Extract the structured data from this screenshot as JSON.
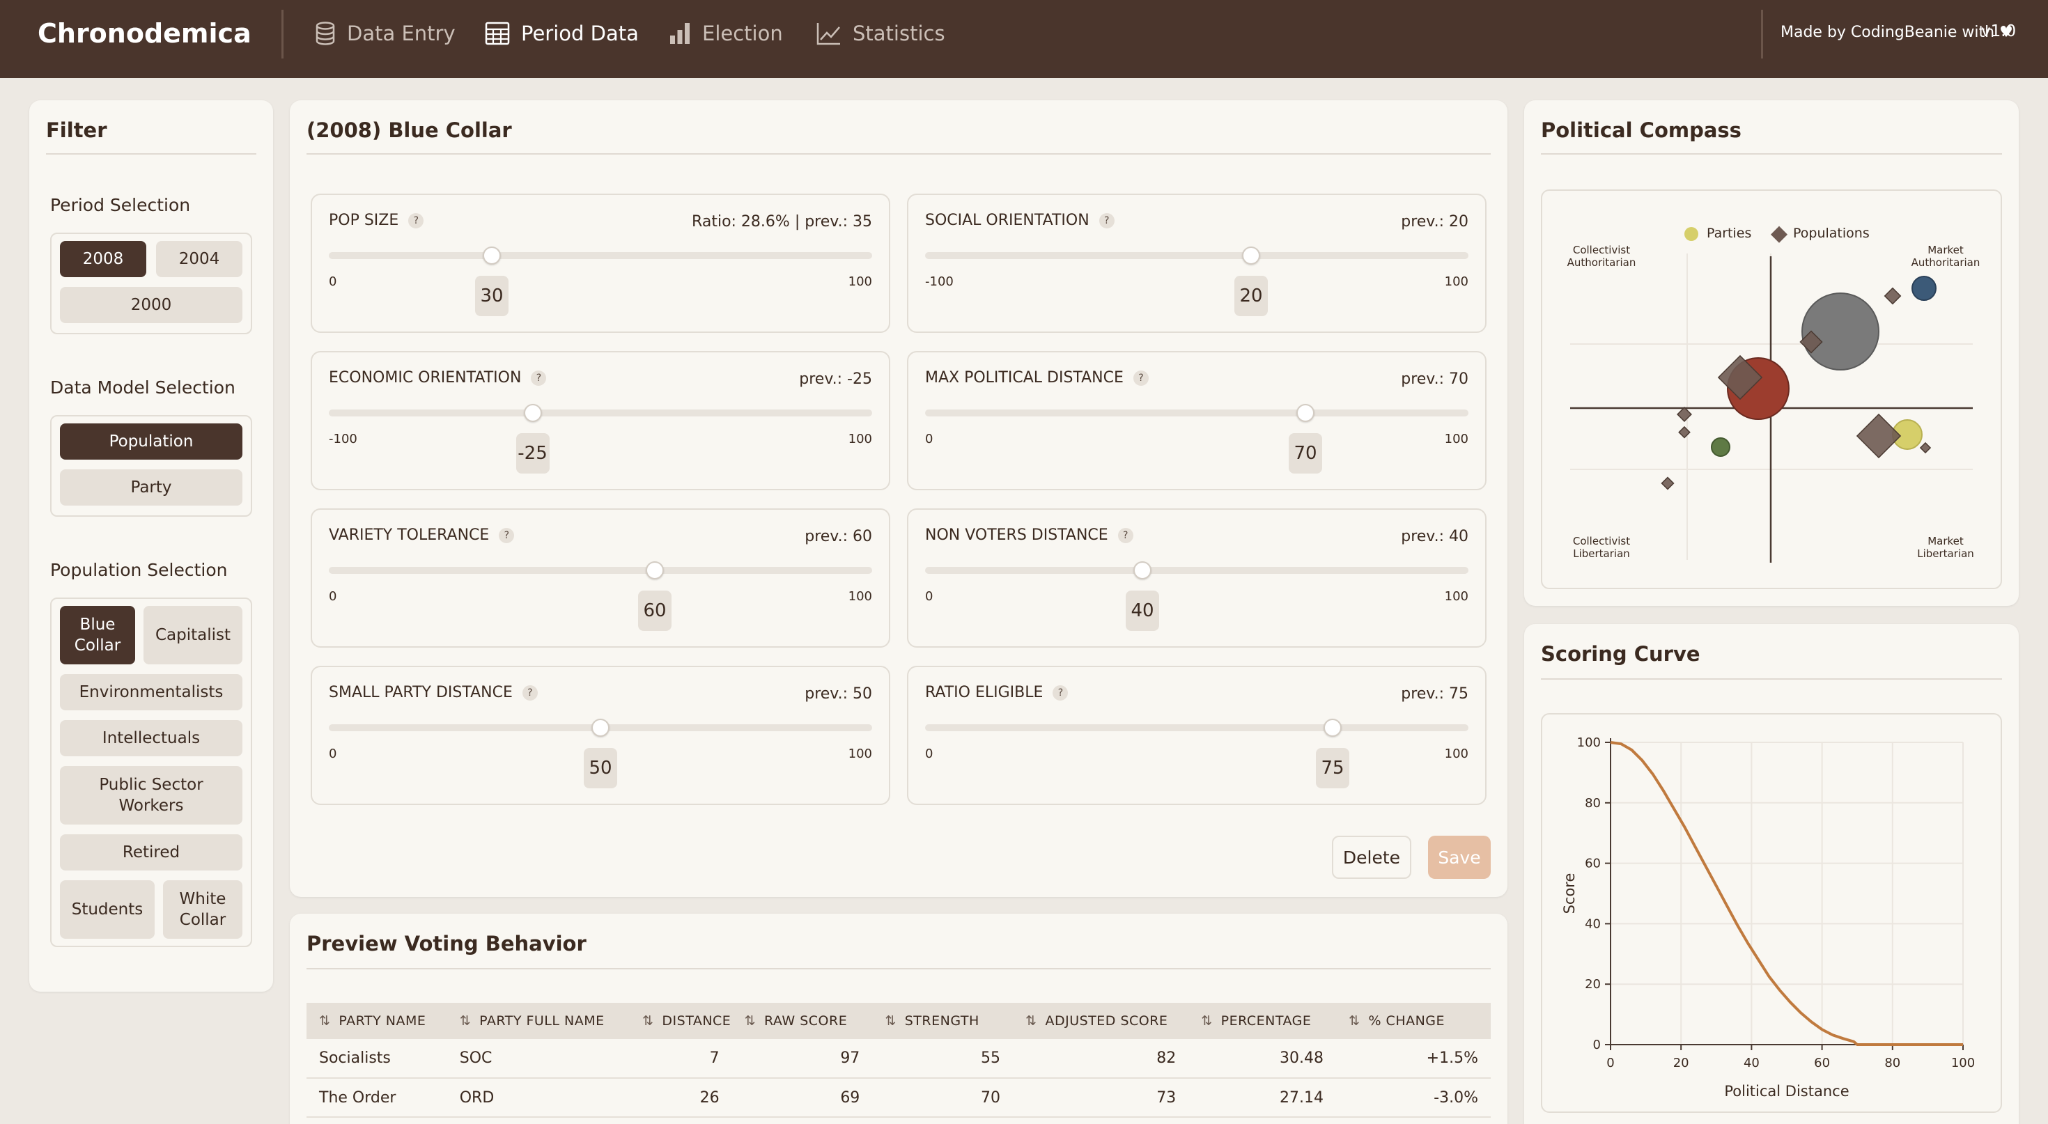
{
  "app": {
    "title": "Chronodemica",
    "made_by": "Made by CodingBeanie with",
    "version": "v1.0"
  },
  "nav": [
    {
      "label": "Data Entry",
      "icon": "database-icon"
    },
    {
      "label": "Period Data",
      "icon": "table-icon"
    },
    {
      "label": "Election",
      "icon": "bar-chart-icon"
    },
    {
      "label": "Statistics",
      "icon": "line-chart-icon"
    }
  ],
  "filter": {
    "title": "Filter",
    "period_label": "Period Selection",
    "periods": [
      "2008",
      "2004",
      "2000"
    ],
    "selected_period": "2008",
    "model_label": "Data Model Selection",
    "models": [
      "Population",
      "Party"
    ],
    "selected_model": "Population",
    "population_label": "Population Selection",
    "populations": [
      "Blue Collar",
      "Capitalist",
      "Environmentalists",
      "Intellectuals",
      "Public Sector Workers",
      "Retired",
      "Students",
      "White Collar"
    ],
    "selected_population": "Blue Collar"
  },
  "editor": {
    "title": "(2008) Blue Collar",
    "params": [
      {
        "label": "POP SIZE",
        "help": "?",
        "prev": "Ratio: 28.6% | prev.: 35",
        "min": "0",
        "max": "100",
        "value": "30",
        "level": 0.3
      },
      {
        "label": "SOCIAL ORIENTATION",
        "help": "?",
        "prev": "prev.: 20",
        "min": "-100",
        "max": "100",
        "value": "20",
        "level": 0.6
      },
      {
        "label": "ECONOMIC ORIENTATION",
        "help": "?",
        "prev": "prev.: -25",
        "min": "-100",
        "max": "100",
        "value": "-25",
        "level": 0.375
      },
      {
        "label": "MAX POLITICAL DISTANCE",
        "help": "?",
        "prev": "prev.: 70",
        "min": "0",
        "max": "100",
        "value": "70",
        "level": 0.7
      },
      {
        "label": "VARIETY TOLERANCE",
        "help": "?",
        "prev": "prev.: 60",
        "min": "0",
        "max": "100",
        "value": "60",
        "level": 0.6
      },
      {
        "label": "NON VOTERS DISTANCE",
        "help": "?",
        "prev": "prev.: 40",
        "min": "0",
        "max": "100",
        "value": "40",
        "level": 0.4
      },
      {
        "label": "SMALL PARTY DISTANCE",
        "help": "?",
        "prev": "prev.: 50",
        "min": "0",
        "max": "100",
        "value": "50",
        "level": 0.5
      },
      {
        "label": "RATIO ELIGIBLE",
        "help": "?",
        "prev": "prev.: 75",
        "min": "0",
        "max": "100",
        "value": "75",
        "level": 0.75
      }
    ],
    "delete_label": "Delete",
    "save_label": "Save"
  },
  "preview": {
    "title": "Preview Voting Behavior",
    "columns": [
      "PARTY NAME",
      "PARTY FULL NAME",
      "DISTANCE",
      "RAW SCORE",
      "STRENGTH",
      "ADJUSTED SCORE",
      "PERCENTAGE",
      "% CHANGE"
    ],
    "rows": [
      [
        "Socialists",
        "SOC",
        "7",
        "97",
        "55",
        "82",
        "30.48",
        "+1.5%"
      ],
      [
        "The Order",
        "ORD",
        "26",
        "69",
        "70",
        "73",
        "27.14",
        "-3.0%"
      ]
    ]
  },
  "compass": {
    "title": "Political Compass",
    "legend": [
      "Parties",
      "Populations"
    ],
    "quadrants": {
      "top_left": "Collectivist Authoritarian",
      "top_right": "Market Authoritarian",
      "bottom_left": "Collectivist Libertarian",
      "bottom_right": "Market Libertarian"
    },
    "colors": {
      "parties_legend": "#d6cf6a",
      "populations_legend": "#6e5a52"
    }
  },
  "scoring": {
    "title": "Scoring Curve",
    "chart_data": {
      "type": "line",
      "xlabel": "Political Distance",
      "ylabel": "Score",
      "xlim": [
        0,
        100
      ],
      "ylim": [
        0,
        100
      ],
      "xticks": [
        "0",
        "20",
        "40",
        "60",
        "80",
        "100"
      ],
      "yticks": [
        "0",
        "20",
        "40",
        "60",
        "80",
        "100"
      ],
      "x": [
        0,
        3,
        6,
        9,
        12,
        15,
        18,
        21,
        24,
        27,
        30,
        33,
        36,
        39,
        42,
        45,
        48,
        51,
        54,
        57,
        60,
        63,
        66,
        69,
        70,
        71,
        75,
        80,
        90,
        100
      ],
      "y": [
        100,
        99.5,
        97.5,
        94,
        89.5,
        84,
        78,
        72,
        65.5,
        59,
        52.5,
        46,
        39.5,
        33.5,
        28,
        22.5,
        18,
        14,
        10.5,
        7.5,
        5,
        3.2,
        2,
        1,
        0,
        0,
        0,
        0,
        0,
        0
      ],
      "color": "#c07a3e"
    }
  }
}
